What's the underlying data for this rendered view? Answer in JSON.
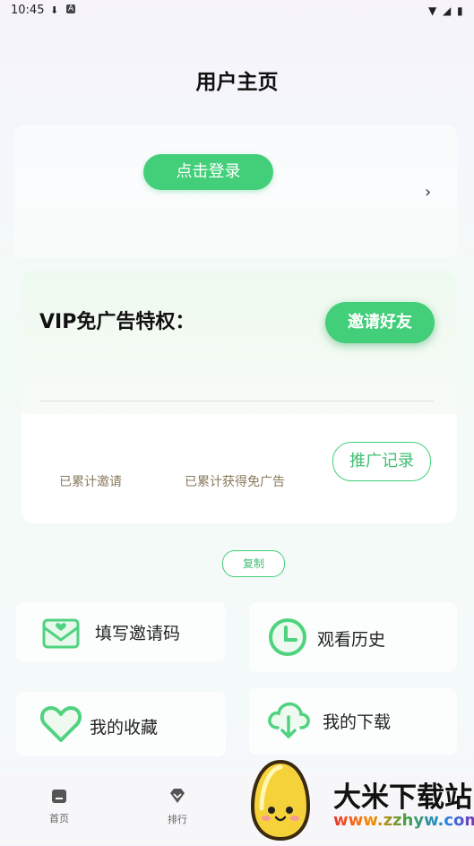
{
  "status_bar": {
    "time": "10:45",
    "download_icon": "download-icon",
    "a_icon": "A"
  },
  "header": {
    "title": "用户主页"
  },
  "login": {
    "button_label": "点击登录"
  },
  "vip": {
    "title": "VIP免广告特权：",
    "invite_button": "邀请好友",
    "stat_invited_label": "已累计邀请",
    "stat_adfree_label": "已累计获得免广告",
    "promo_button": "推广记录"
  },
  "copy": {
    "label": "复制"
  },
  "tiles": [
    {
      "label": "填写邀请码",
      "icon": "envelope-heart-icon"
    },
    {
      "label": "观看历史",
      "icon": "clock-icon"
    },
    {
      "label": "我的收藏",
      "icon": "heart-icon"
    },
    {
      "label": "我的下载",
      "icon": "cloud-download-icon"
    }
  ],
  "tabbar": {
    "home": "首页",
    "rank": "排行"
  },
  "watermark": {
    "text": "大米下载站",
    "url": "www.zzhyw.com"
  },
  "colors": {
    "accent": "#43cf7a",
    "stat_text": "#8a7a5c"
  }
}
